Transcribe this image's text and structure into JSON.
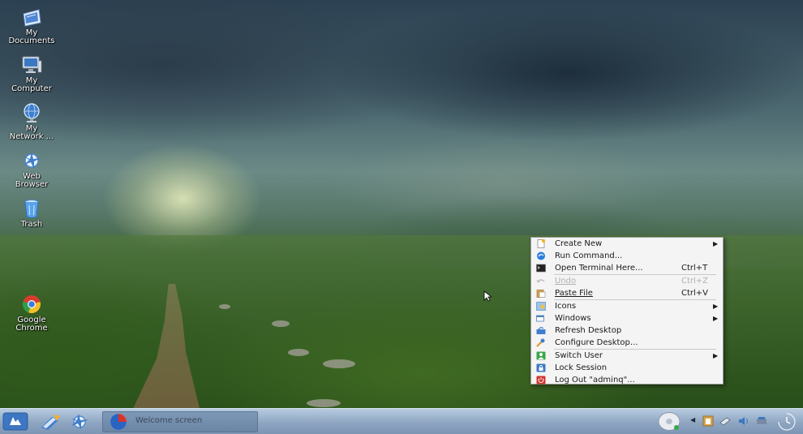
{
  "desktop_icons": [
    {
      "name": "my-documents",
      "label": "My\nDocuments",
      "icon": "folder-documents-icon"
    },
    {
      "name": "my-computer",
      "label": "My\nComputer",
      "icon": "computer-icon"
    },
    {
      "name": "my-network",
      "label": "My\nNetwork ...",
      "icon": "network-globe-icon"
    },
    {
      "name": "web-browser",
      "label": "Web\nBrowser",
      "icon": "web-browser-icon"
    },
    {
      "name": "trash",
      "label": "Trash",
      "icon": "trash-icon"
    },
    {
      "name": "google-chrome",
      "label": "Google\nChrome",
      "icon": "chrome-icon"
    }
  ],
  "context_menu": {
    "items": [
      {
        "label": "Create New",
        "shortcut": "",
        "submenu": true,
        "disabled": false,
        "icon": "new-document-icon"
      },
      {
        "label": "Run Command...",
        "shortcut": "",
        "submenu": false,
        "disabled": false,
        "icon": "run-command-icon"
      },
      {
        "label": "Open Terminal Here...",
        "shortcut": "Ctrl+T",
        "submenu": false,
        "disabled": false,
        "icon": "terminal-icon"
      },
      {
        "label": "Undo",
        "shortcut": "Ctrl+Z",
        "submenu": false,
        "disabled": true,
        "icon": "undo-icon"
      },
      {
        "label": "Paste File",
        "shortcut": "Ctrl+V",
        "submenu": false,
        "disabled": false,
        "icon": "paste-icon"
      },
      {
        "label": "Icons",
        "shortcut": "",
        "submenu": true,
        "disabled": false,
        "icon": "icons-icon"
      },
      {
        "label": "Windows",
        "shortcut": "",
        "submenu": true,
        "disabled": false,
        "icon": "windows-icon"
      },
      {
        "label": "Refresh Desktop",
        "shortcut": "",
        "submenu": false,
        "disabled": false,
        "icon": "refresh-icon"
      },
      {
        "label": "Configure Desktop...",
        "shortcut": "",
        "submenu": false,
        "disabled": false,
        "icon": "configure-icon"
      },
      {
        "label": "Switch User",
        "shortcut": "",
        "submenu": true,
        "disabled": false,
        "icon": "switch-user-icon"
      },
      {
        "label": "Lock Session",
        "shortcut": "",
        "submenu": false,
        "disabled": false,
        "icon": "lock-icon"
      },
      {
        "label": "Log Out \"adminq\"...",
        "shortcut": "",
        "submenu": false,
        "disabled": false,
        "icon": "logout-icon"
      }
    ],
    "submenu_arrow": "▶"
  },
  "taskbar": {
    "task_label": "Welcome screen",
    "start_icon": "start-menu-icon",
    "quick_launch": [
      "home-folder-icon",
      "web-browser-icon"
    ],
    "tray_icons": [
      "disc-icon",
      "expand-arrow-icon",
      "klipper-icon",
      "network-icon",
      "volume-icon",
      "usb-device-icon",
      "clock-icon"
    ],
    "tray_arrow": "◀"
  },
  "colors": {
    "menu_bg": "#f4f4f4",
    "taskbar_top": "#b7cbe0",
    "taskbar_bottom": "#7c95b4",
    "logout_red": "#d0302a"
  }
}
